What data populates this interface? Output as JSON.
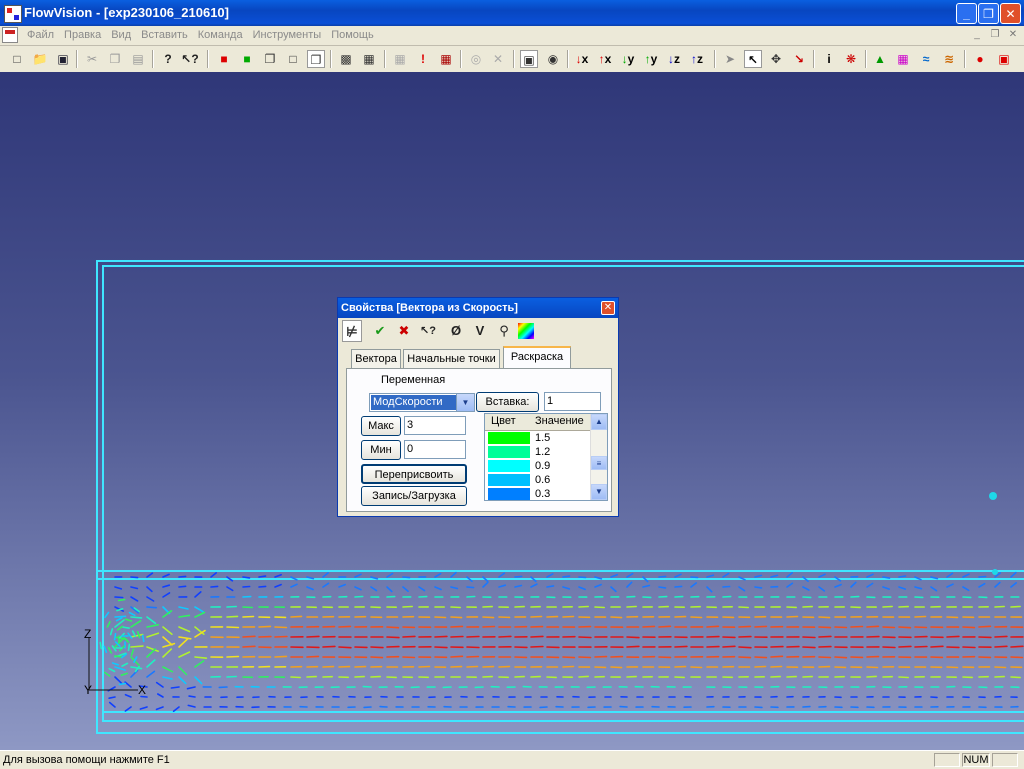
{
  "window": {
    "title": "FlowVision - [exp230106_210610]",
    "controls": {
      "minimize": "_",
      "maximize": "❐",
      "close": "✕"
    }
  },
  "menu": {
    "items": [
      "Файл",
      "Правка",
      "Вид",
      "Вставить",
      "Команда",
      "Инструменты",
      "Помощь"
    ],
    "mdi_controls": {
      "minimize": "_",
      "restore": "❐",
      "close": "✕"
    }
  },
  "toolbar": {
    "axis_labels": {
      "mx": "x",
      "px": "x",
      "my": "y",
      "py": "y",
      "mz": "z",
      "pz": "z"
    },
    "info_label": "i"
  },
  "viewport": {
    "axes": {
      "z": "Z",
      "y": "Y",
      "x": "X"
    }
  },
  "dialog": {
    "title": "Свойства [Вектора из Скорость]",
    "tabs": [
      "Вектора",
      "Начальные точки",
      "Раскраска"
    ],
    "active_tab": "Раскраска",
    "tool_labels": {
      "clear": "Ø",
      "v": "V"
    },
    "variable_label": "Переменная",
    "variable_value": "МодСкорости",
    "max_label": "Макс",
    "max_value": "3",
    "min_label": "Мин",
    "min_value": "0",
    "reassign_label": "Переприсвоить",
    "saveload_label": "Запись/Загрузка",
    "insert_label": "Вставка:",
    "insert_value": "1",
    "table": {
      "headers": [
        "Цвет",
        "Значение"
      ],
      "rows": [
        {
          "color": "#00ff00",
          "value": "1.5"
        },
        {
          "color": "#00ff99",
          "value": "1.2"
        },
        {
          "color": "#00ffff",
          "value": "0.9"
        },
        {
          "color": "#00bfff",
          "value": "0.6"
        },
        {
          "color": "#007fff",
          "value": "0.3"
        }
      ]
    }
  },
  "statusbar": {
    "message": "Для вызова помощи нажмите F1",
    "num": "NUM"
  }
}
